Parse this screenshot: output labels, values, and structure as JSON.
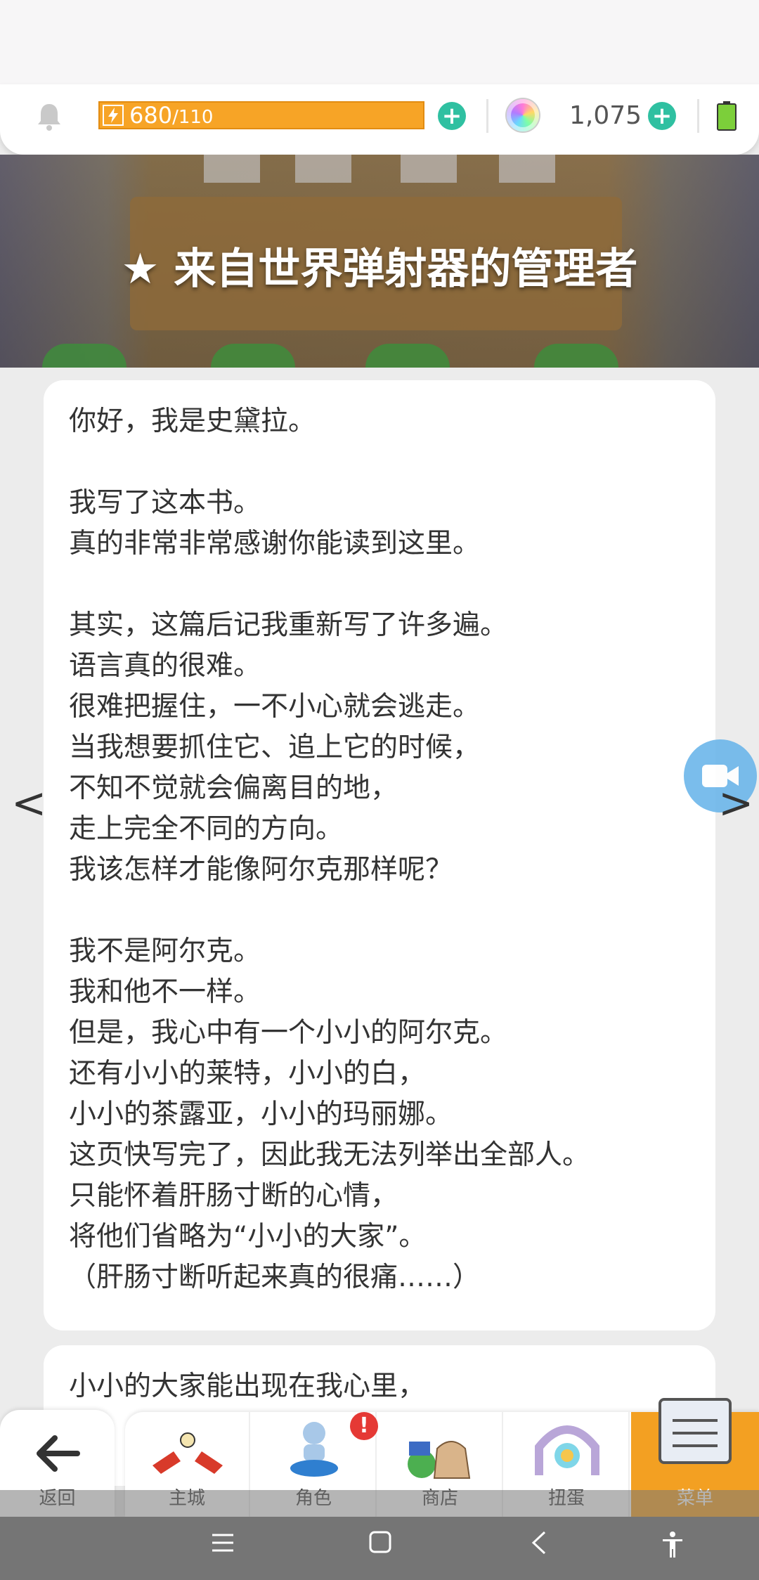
{
  "status": {
    "stamina_current": "680",
    "stamina_max": "/110",
    "gems": "1,075"
  },
  "banner": {
    "title": "★ 来自世界弹射器的管理者"
  },
  "card1_lines": [
    "你好，我是史黛拉。",
    "",
    "我写了这本书。",
    "真的非常非常感谢你能读到这里。",
    "",
    "其实，这篇后记我重新写了许多遍。",
    "语言真的很难。",
    "很难把握住，一不小心就会逃走。",
    "当我想要抓住它、追上它的时候，",
    "不知不觉就会偏离目的地，",
    "走上完全不同的方向。",
    "我该怎样才能像阿尔克那样呢？",
    "",
    "我不是阿尔克。",
    "我和他不一样。",
    "但是，我心中有一个小小的阿尔克。",
    "还有小小的莱特，小小的白，",
    "小小的茶露亚，小小的玛丽娜。",
    "这页快写完了，因此我无法列举出全部人。",
    "只能怀着肝肠寸断的心情，",
    "将他们省略为“小小的大家”。",
    "（肝肠寸断听起来真的很痛……）"
  ],
  "card2_lines": [
    "小小的大家能出现在我心里，"
  ],
  "nav": {
    "back": "返回",
    "tabs": [
      "主城",
      "角色",
      "商店",
      "扭蛋",
      "菜单"
    ],
    "badge": "!"
  },
  "pager": {
    "prev": "<",
    "next": ">"
  },
  "colors": {
    "stamina": "#f7a426",
    "plus": "#2fc0a1",
    "active_tab": "#f3a022"
  }
}
